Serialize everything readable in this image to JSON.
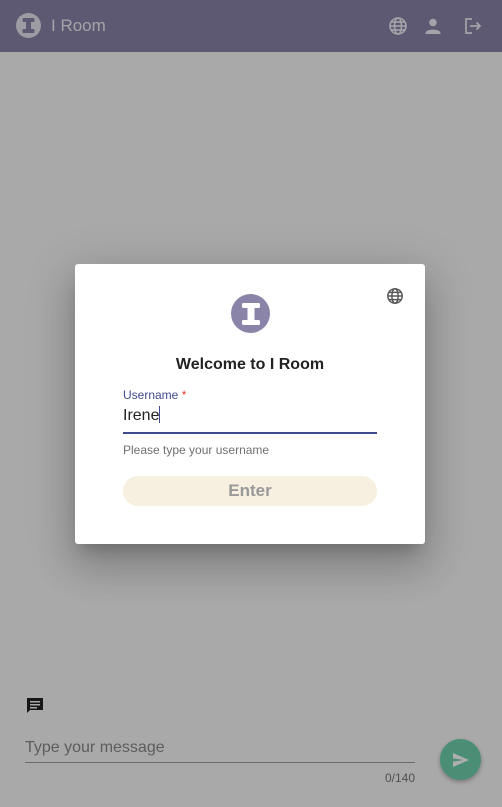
{
  "app": {
    "title": "I Room",
    "logo_letter": "I"
  },
  "appbar_icons": [
    "globe-icon",
    "person-icon",
    "logout-icon"
  ],
  "chat": {
    "message_placeholder": "Type your message",
    "counter": "0/140"
  },
  "dialog": {
    "logo_letter": "I",
    "welcome": "Welcome to I Room",
    "username_label": "Username",
    "required_mark": "*",
    "username_value": "Irene",
    "hint": "Please type your username",
    "enter_label": "Enter"
  },
  "colors": {
    "appbar": "#8a84a8",
    "accent": "#3f4a8f",
    "send_button": "#6fd1ae",
    "enter_button": "#f7f0e1"
  }
}
